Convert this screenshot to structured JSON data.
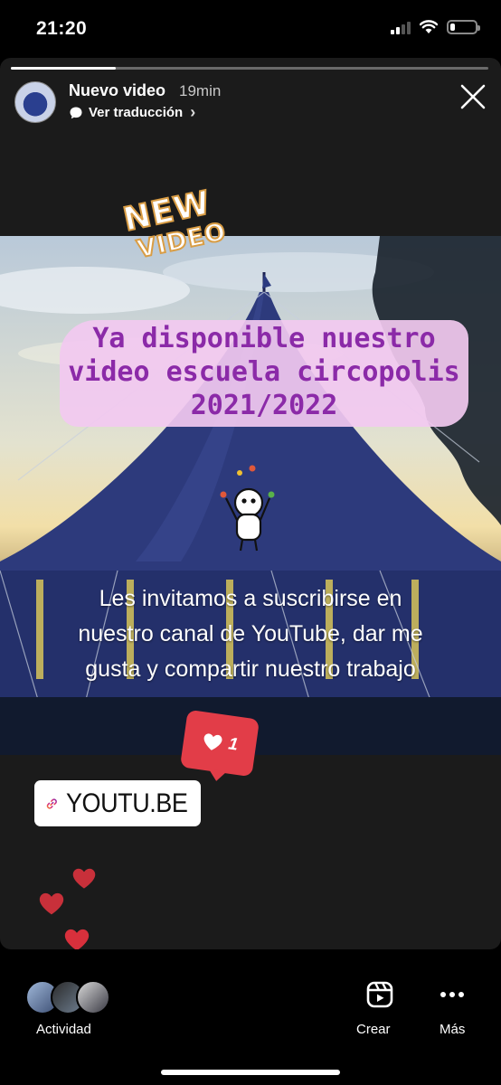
{
  "status_bar": {
    "time": "21:20",
    "icons": [
      "signal-icon",
      "wifi-icon",
      "battery-icon"
    ],
    "battery_level": 0.2,
    "signal_bars_active": 2
  },
  "story": {
    "progress_fraction": 0.22,
    "account_name": "Nuevo video",
    "time_ago": "19min",
    "translate_label": "Ver traducción",
    "badge_line1": "NEW",
    "badge_line2": "VIDEO",
    "caption_line1": "Ya disponible nuestro",
    "caption_line2": "video escuela circopolis",
    "caption_line3": "2021/2022",
    "invite_line1": "Les invitamos a suscribirse en",
    "invite_line2": "nuestro canal de YouTube, dar me",
    "invite_line3": "gusta y compartir nuestro trabajo",
    "like_count": "1",
    "link_label": "YOUTU.BE"
  },
  "bottom_bar": {
    "activity_label": "Actividad",
    "create_label": "Crear",
    "more_label": "Más"
  },
  "colors": {
    "caption_purple": "#8b2aa8",
    "caption_highlight": "#f2c9f0",
    "like_red": "#e23d48",
    "heart_red": "#d8303c",
    "tent_blue": "#2d3a7c"
  }
}
